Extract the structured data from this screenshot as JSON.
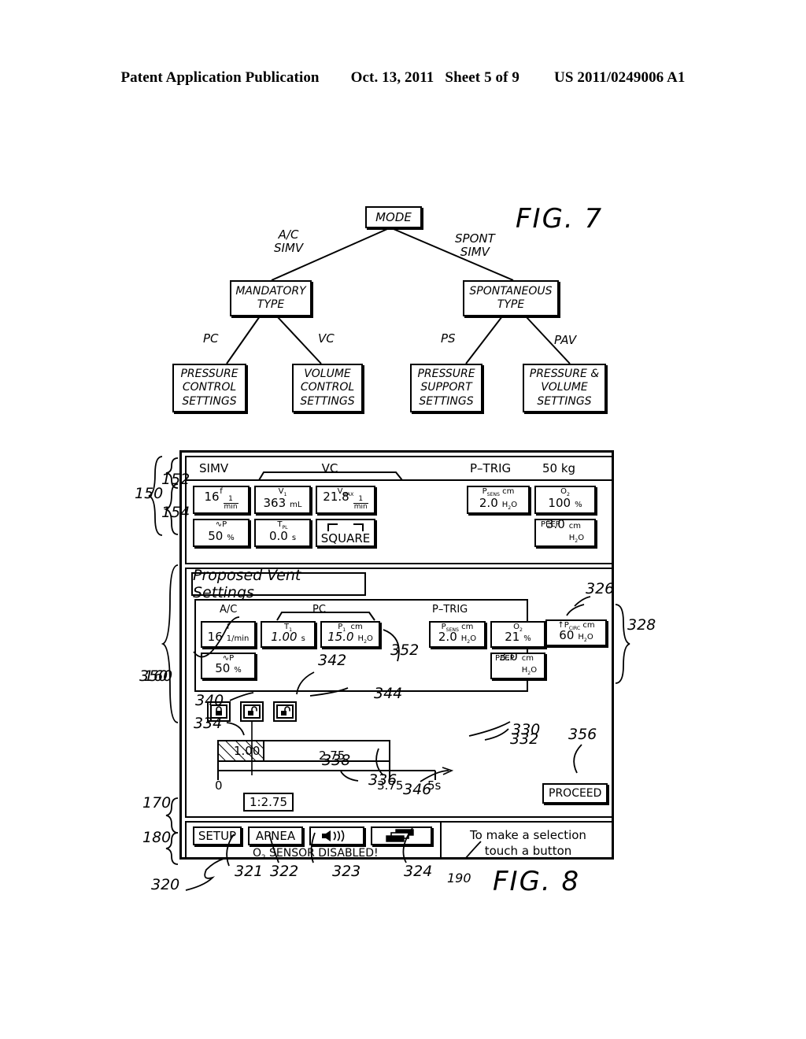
{
  "header": {
    "publication": "Patent Application Publication",
    "date": "Oct. 13, 2011",
    "sheet": "Sheet 5 of 9",
    "docnum": "US 2011/0249006 A1"
  },
  "fig7": {
    "label": "FIG. 7",
    "root": "MODE",
    "branch_left_label": "A/C\nSIMV",
    "branch_left_line1": "A/C",
    "branch_left_line2": "SIMV",
    "branch_right_line1": "SPONT",
    "branch_right_line2": "SIMV",
    "left_node_line1": "MANDATORY",
    "left_node_line2": "TYPE",
    "right_node_line1": "SPONTANEOUS",
    "right_node_line2": "TYPE",
    "edge_pc": "PC",
    "edge_vc": "VC",
    "edge_ps": "PS",
    "edge_pav": "PAV",
    "leaf1": [
      "PRESSURE",
      "CONTROL",
      "SETTINGS"
    ],
    "leaf2": [
      "VOLUME",
      "CONTROL",
      "SETTINGS"
    ],
    "leaf3": [
      "PRESSURE",
      "SUPPORT",
      "SETTINGS"
    ],
    "leaf4": [
      "PRESSURE &",
      "VOLUME",
      "SETTINGS"
    ]
  },
  "fig8": {
    "label": "FIG. 8",
    "current": {
      "mode": "SIMV",
      "breath_type": "VC",
      "trigger": "P–TRIG",
      "weight": "50 kg",
      "settings": [
        {
          "label": "f",
          "value": "16",
          "unit": "1/min",
          "id": "f"
        },
        {
          "label": "V1",
          "value": "363",
          "unit": "mL",
          "id": "vt"
        },
        {
          "label": "VMAX",
          "value": "21.8",
          "unit": "1/min",
          "id": "vmax"
        },
        {
          "label": "P",
          "value": "50",
          "unit": "%",
          "id": "rise"
        },
        {
          "label": "TPL",
          "value": "0.0",
          "unit": "s",
          "id": "tpl"
        },
        {
          "label": "",
          "value": "SQUARE",
          "unit": "",
          "id": "waveform"
        }
      ],
      "right_settings": [
        {
          "label": "PSENS",
          "value": "2.0",
          "unit": "cm H2O",
          "id": "psens"
        },
        {
          "label": "O2",
          "value": "100",
          "unit": "%",
          "id": "o2"
        },
        {
          "label": "PEEP",
          "value": "3.0",
          "unit": "cm H2O",
          "id": "peep"
        }
      ]
    },
    "proposed": {
      "title": "Proposed Vent Settings",
      "mode": "A/C",
      "breath_type": "PC",
      "trigger": "P–TRIG",
      "settings": [
        {
          "label": "f",
          "value": "16",
          "unit": "1/min",
          "id": "f",
          "changed": false
        },
        {
          "label": "T1",
          "value": "1.00",
          "unit": "s",
          "id": "ti",
          "changed": true
        },
        {
          "label": "P1",
          "value": "15.0",
          "unit": "cm H2O",
          "id": "pi",
          "changed": true
        },
        {
          "label": "P",
          "value": "50",
          "unit": "%",
          "id": "rise",
          "changed": false
        }
      ],
      "right_settings": [
        {
          "label": "PSENS",
          "value": "2.0",
          "unit": "cm H2O",
          "id": "psens"
        },
        {
          "label": "O2",
          "value": "21",
          "unit": "%",
          "id": "o2"
        },
        {
          "label": "PEEP",
          "value": "3.0",
          "unit": "cm H2O",
          "id": "peep"
        }
      ],
      "alarm": {
        "label": "↑PCIRC",
        "value": "60",
        "unit": "cm H2O",
        "id": "pcirc"
      },
      "locks": [
        {
          "id": "lock-closed",
          "state": "locked"
        },
        {
          "id": "lock-open-1",
          "state": "unlocked"
        },
        {
          "id": "lock-open-2",
          "state": "unlocked"
        }
      ],
      "timeline": {
        "inspiratory_time": "1.00",
        "expiratory_time": "2.75",
        "ratio": "1:2.75",
        "tick_start": "0",
        "tick_cycle_end": "3.75",
        "tick_end": "5s",
        "axis_max_s": 5,
        "inspiration_start_s": 0,
        "inspiration_end_s": 1.0,
        "expiration_end_s": 3.75
      },
      "proceed_label": "PROCEED"
    },
    "bottom": {
      "buttons": [
        {
          "label": "SETUP",
          "id": "setup-button"
        },
        {
          "label": "APNEA",
          "id": "apnea-button"
        },
        {
          "label": "",
          "id": "alarm-silence-button",
          "icon": "speaker-icon"
        },
        {
          "label": "",
          "id": "screens-button",
          "icon": "screens-icon"
        }
      ],
      "alert_line": "O2 SENSOR DISABLED!",
      "alert_prefix": "O",
      "alert_sub": "2",
      "alert_rest": "SENSOR  DISABLED!",
      "message_line1": "To make a selection",
      "message_line2": "touch a button"
    },
    "refnums": [
      {
        "id": "ref-150",
        "text": "150"
      },
      {
        "id": "ref-152",
        "text": "152"
      },
      {
        "id": "ref-154",
        "text": "154"
      },
      {
        "id": "ref-160",
        "text": "160"
      },
      {
        "id": "ref-170",
        "text": "170"
      },
      {
        "id": "ref-180",
        "text": "180"
      },
      {
        "id": "ref-190",
        "text": "190"
      },
      {
        "id": "ref-320",
        "text": "320"
      },
      {
        "id": "ref-321",
        "text": "321"
      },
      {
        "id": "ref-322",
        "text": "322"
      },
      {
        "id": "ref-323",
        "text": "323"
      },
      {
        "id": "ref-324",
        "text": "324"
      },
      {
        "id": "ref-326",
        "text": "326"
      },
      {
        "id": "ref-328",
        "text": "328"
      },
      {
        "id": "ref-330",
        "text": "330"
      },
      {
        "id": "ref-332",
        "text": "332"
      },
      {
        "id": "ref-334",
        "text": "334"
      },
      {
        "id": "ref-336",
        "text": "336"
      },
      {
        "id": "ref-338",
        "text": "338"
      },
      {
        "id": "ref-340",
        "text": "340"
      },
      {
        "id": "ref-342",
        "text": "342"
      },
      {
        "id": "ref-344",
        "text": "344"
      },
      {
        "id": "ref-346",
        "text": "346"
      },
      {
        "id": "ref-350",
        "text": "350"
      },
      {
        "id": "ref-352",
        "text": "352"
      },
      {
        "id": "ref-356",
        "text": "356"
      }
    ]
  }
}
